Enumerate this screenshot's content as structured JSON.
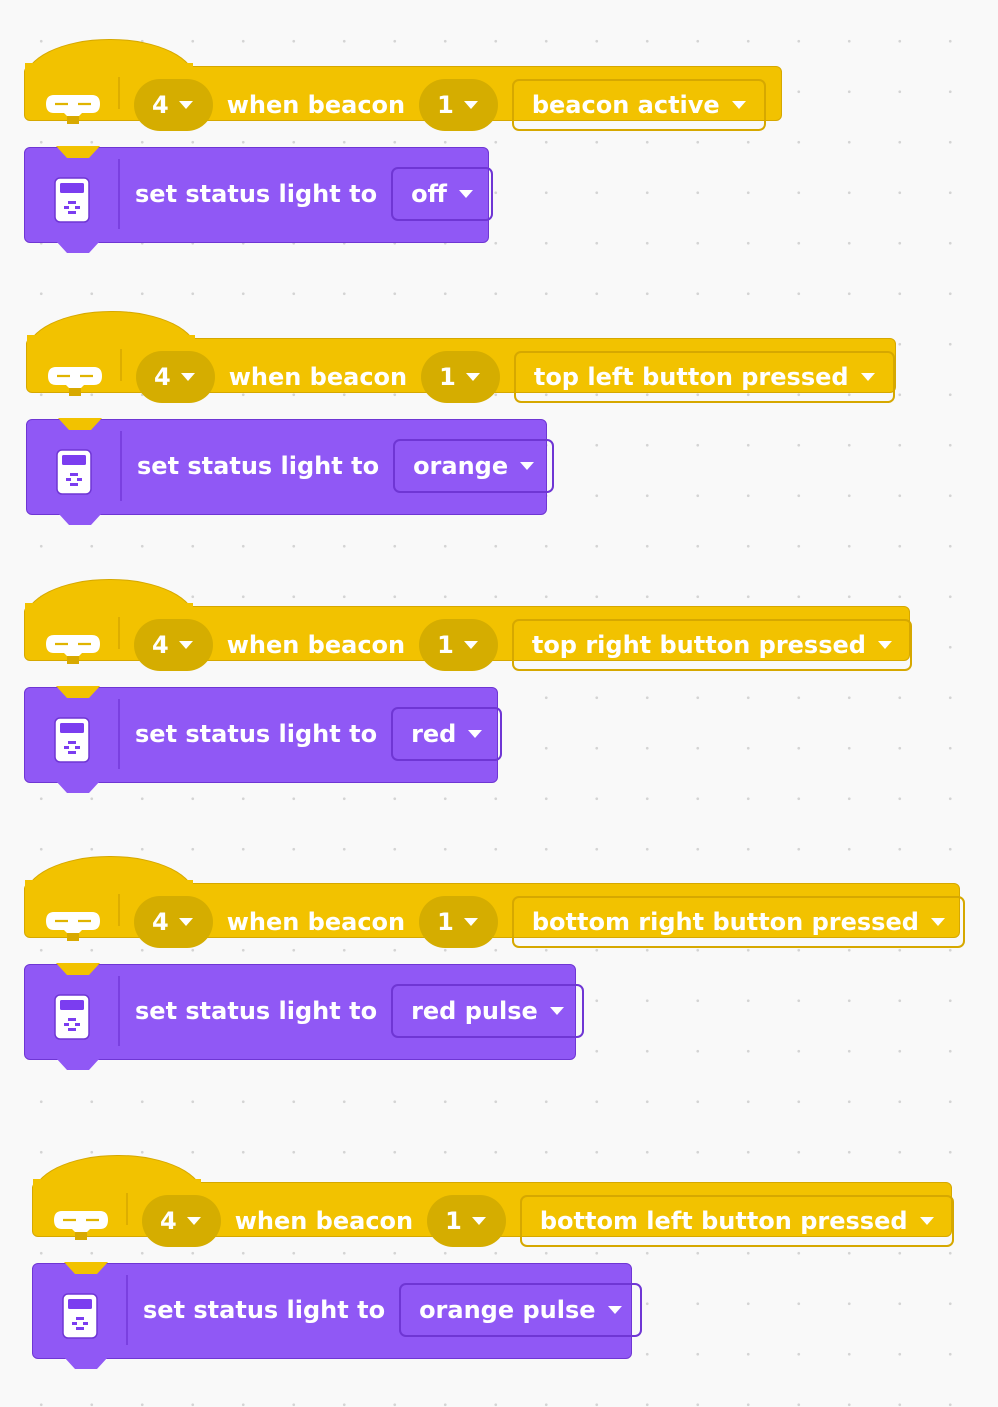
{
  "blocks": [
    {
      "hub": "4",
      "event_label": "when beacon",
      "beacon": "1",
      "event": "beacon active",
      "action_label": "set status light to",
      "light": "off"
    },
    {
      "hub": "4",
      "event_label": "when beacon",
      "beacon": "1",
      "event": "top left button pressed",
      "action_label": "set status light to",
      "light": "orange"
    },
    {
      "hub": "4",
      "event_label": "when beacon",
      "beacon": "1",
      "event": "top right button pressed",
      "action_label": "set status light to",
      "light": "red"
    },
    {
      "hub": "4",
      "event_label": "when beacon",
      "beacon": "1",
      "event": "bottom right button pressed",
      "action_label": "set status light to",
      "light": "red pulse"
    },
    {
      "hub": "4",
      "event_label": "when beacon",
      "beacon": "1",
      "event": "bottom left button pressed",
      "action_label": "set status light to",
      "light": "orange pulse"
    }
  ],
  "colors": {
    "event_block": "#f2c200",
    "action_block": "#9058f5"
  },
  "icons": {
    "event": "beacon-icon",
    "action": "hub-status-light-icon",
    "dropdown": "caret-down-icon"
  }
}
